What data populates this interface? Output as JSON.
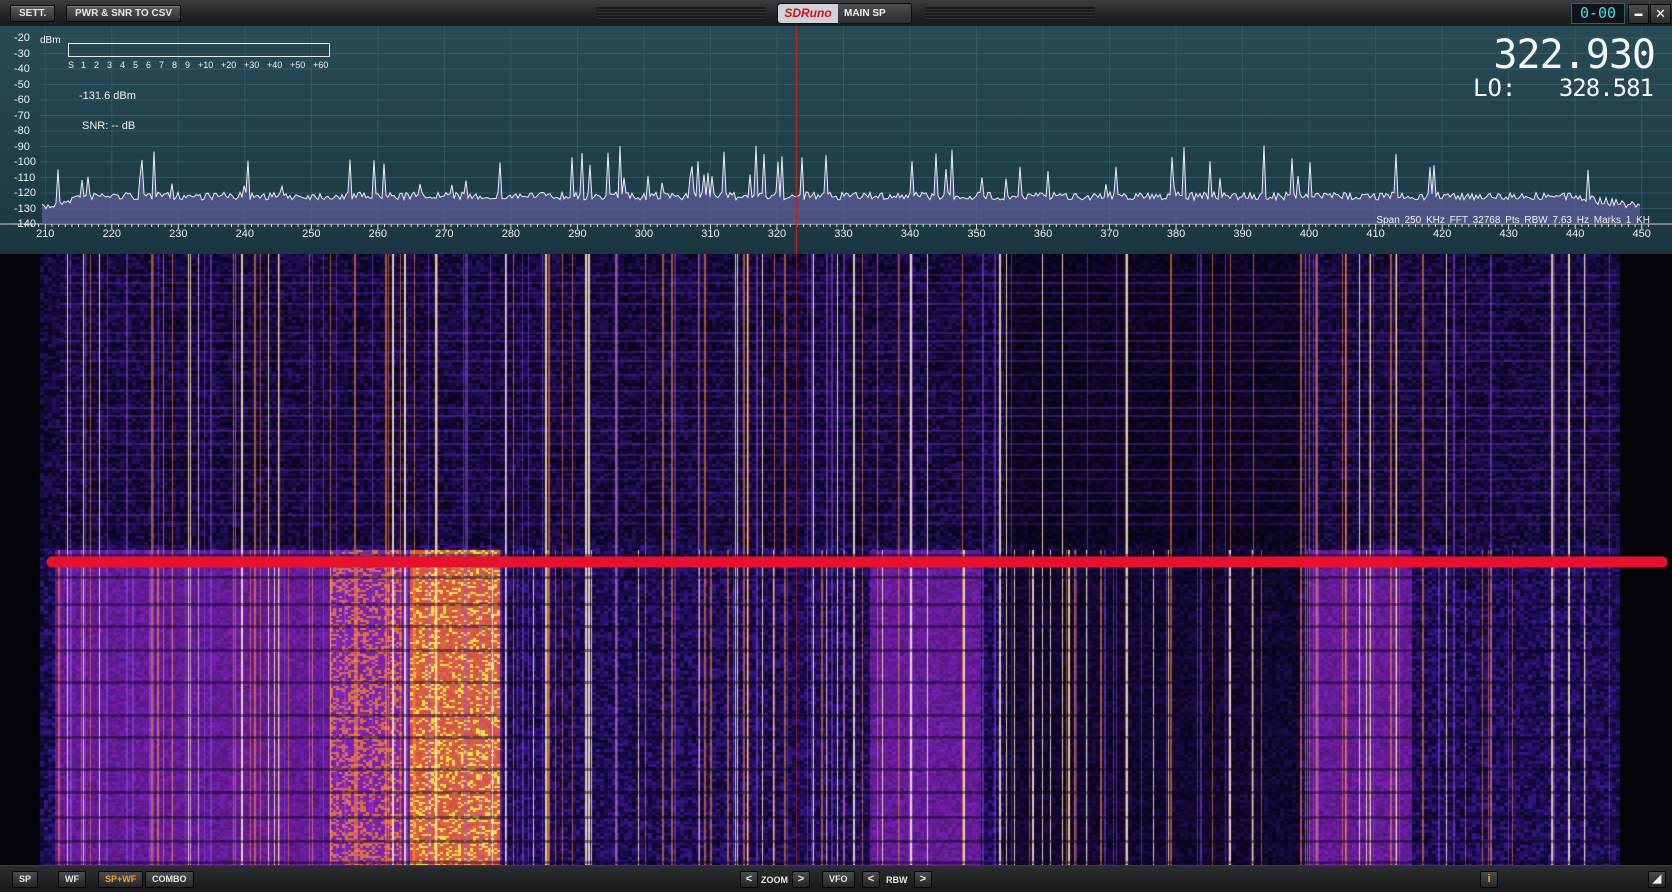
{
  "titlebar": {
    "settings_label": "SETT.",
    "csv_label": "PWR & SNR TO CSV",
    "brand_logo": "SDRuno",
    "window_name": "MAIN SP",
    "clock": "0-00",
    "minimize_glyph": "▬",
    "close_glyph": "✕"
  },
  "spectrum": {
    "y_unit": "dBm",
    "y_ticks": [
      "-20",
      "-30",
      "-40",
      "-50",
      "-60",
      "-70",
      "-80",
      "-90",
      "-100",
      "-110",
      "-120",
      "-130",
      "-140"
    ],
    "smeter_ticks": [
      "S",
      "1",
      "2",
      "3",
      "4",
      "5",
      "6",
      "7",
      "8",
      "9",
      "+10",
      "+20",
      "+30",
      "+40",
      "+50",
      "+60"
    ],
    "power_readout": "-131.6 dBm",
    "snr_readout": "SNR: -- dB",
    "frequency": "322.930",
    "lo_label": "LO:",
    "lo_value": "328.581",
    "info_line": "Span 250 KHz  FFT 32768 Pts  RBW 7.63 Hz  Marks 1 KH",
    "x_ticks": [
      "210",
      "220",
      "230",
      "240",
      "250",
      "260",
      "270",
      "280",
      "290",
      "300",
      "310",
      "320",
      "330",
      "340",
      "350",
      "360",
      "370",
      "380",
      "390",
      "400",
      "410",
      "420",
      "430",
      "440",
      "450"
    ],
    "x_range": [
      205,
      452
    ],
    "vfo_freq": 322.93,
    "colors": {
      "background": "#1f4049",
      "trace": "#e9eef6",
      "fill": "#5d5c97",
      "vfo_line": "#c02020"
    }
  },
  "waterfall": {
    "colors": {
      "low": "#07030f",
      "mid": "#3a1fa0",
      "high": "#ff7a1e",
      "peak": "#fff2b0",
      "marker": "#e8102c"
    }
  },
  "bottombar": {
    "sp_label": "SP",
    "wf_label": "WF",
    "spwf_label": "SP+WF",
    "combo_label": "COMBO",
    "zoom_label": "ZOOM",
    "vfo_label": "VFO",
    "rbw_label": "RBW",
    "left_arrow": "<",
    "right_arrow": ">",
    "info_label": "i",
    "resize_glyph": "◢"
  }
}
